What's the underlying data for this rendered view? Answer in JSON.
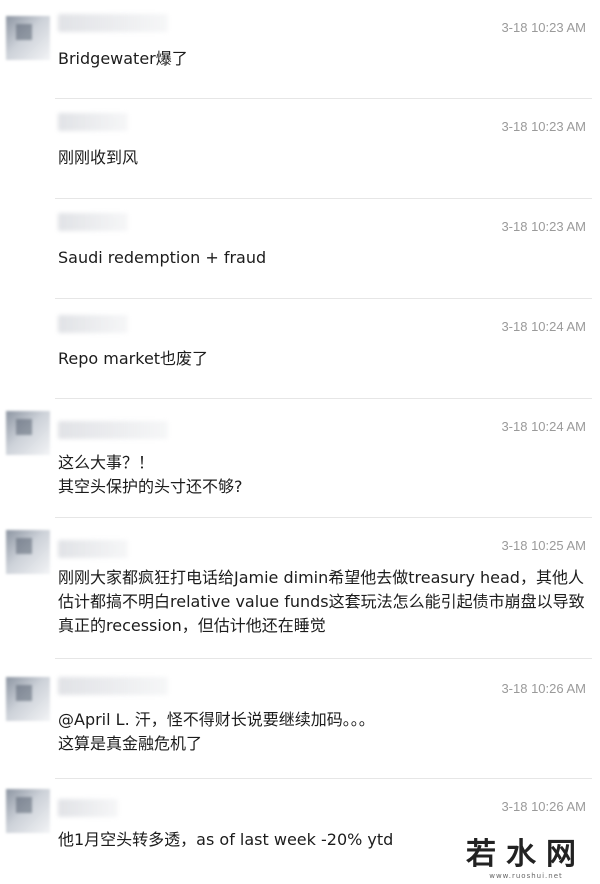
{
  "messages": [
    {
      "time": "3-18 10:23 AM",
      "text": "Bridgewater爆了",
      "has_avatar": true
    },
    {
      "time": "3-18 10:23 AM",
      "text": "刚刚收到风",
      "has_avatar": false
    },
    {
      "time": "3-18 10:23 AM",
      "text": "Saudi redemption + fraud",
      "has_avatar": false
    },
    {
      "time": "3-18 10:24 AM",
      "text": "Repo market也废了",
      "has_avatar": false
    },
    {
      "time": "3-18 10:24 AM",
      "text": "这么大事？！\n其空头保护的头寸还不够?",
      "has_avatar": true
    },
    {
      "time": "3-18 10:25 AM",
      "text": "刚刚大家都疯狂打电话给Jamie dimin希望他去做treasury head，其他人估计都搞不明白relative value funds这套玩法怎么能引起债市崩盘以导致真正的recession，但估计他还在睡觉",
      "has_avatar": true
    },
    {
      "time": "3-18 10:26 AM",
      "text": "@April L. 汗，怪不得财长说要继续加码。。。\n这算是真金融危机了",
      "has_avatar": true
    },
    {
      "time": "3-18 10:26 AM",
      "text": "他1月空头转多透，as of last week -20% ytd",
      "has_avatar": true
    }
  ],
  "watermark": {
    "text": "若水网",
    "sub": "www.ruoshui.net"
  }
}
